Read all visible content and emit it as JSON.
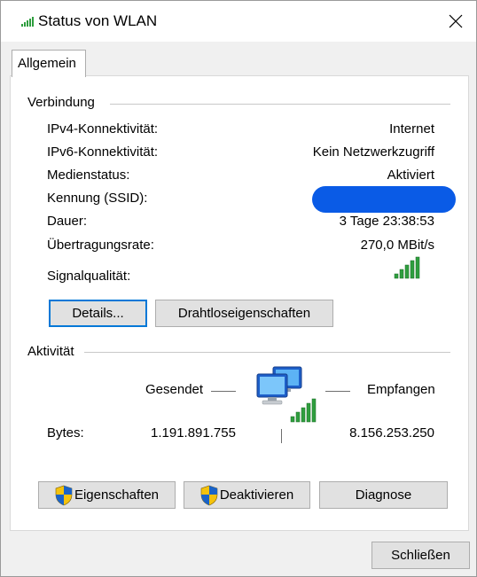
{
  "window": {
    "title": "Status von WLAN",
    "close_glyph": "✕"
  },
  "tab": {
    "label": "Allgemein"
  },
  "connection": {
    "group_label": "Verbindung",
    "rows": [
      {
        "label": "IPv4-Konnektivität:",
        "value": "Internet"
      },
      {
        "label": "IPv6-Konnektivität:",
        "value": "Kein Netzwerkzugriff"
      },
      {
        "label": "Medienstatus:",
        "value": "Aktiviert"
      },
      {
        "label": "Kennung (SSID):",
        "value": ""
      },
      {
        "label": "Dauer:",
        "value": "3 Tage 23:38:53"
      },
      {
        "label": "Übertragungsrate:",
        "value": "270,0 MBit/s"
      }
    ],
    "signal_label": "Signalqualität:",
    "signal_level": 5,
    "signal_max": 5,
    "details_button": "Details...",
    "wireless_props_button": "Drahtloseigenschaften"
  },
  "activity": {
    "group_label": "Aktivität",
    "sent_label": "Gesendet",
    "received_label": "Empfangen",
    "bytes_label": "Bytes:",
    "bytes_sent": "1.191.891.755",
    "bytes_received": "8.156.253.250"
  },
  "buttons": {
    "properties": "Eigenschaften",
    "disable": "Deaktivieren",
    "diagnose": "Diagnose",
    "close": "Schließen"
  },
  "colors": {
    "accent": "#0078d7",
    "signal": "#2e9e3e",
    "redaction": "#0a5be6"
  },
  "icons": [
    "wifi-signal-icon",
    "close-icon",
    "shield-icon",
    "network-computers-icon"
  ]
}
